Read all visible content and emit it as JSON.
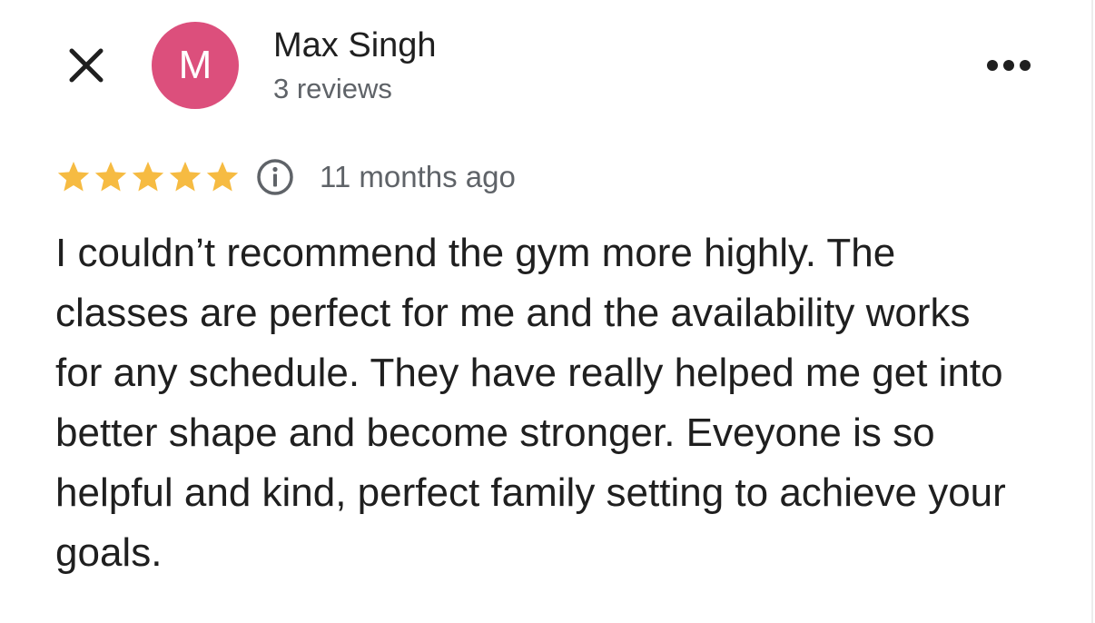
{
  "header": {
    "author": {
      "initial": "M",
      "name": "Max Singh",
      "review_count": "3 reviews",
      "avatar_color": "#dc4f7c"
    }
  },
  "icons": {
    "close": "close-icon",
    "more": "more-vert-dots-icon",
    "info": "info-icon",
    "star": "star-icon"
  },
  "review": {
    "rating": 5,
    "max_rating": 5,
    "time": "11 months ago",
    "text": "I couldn’t recommend the gym more highly. The classes are perfect for me and the availability works for any schedule. They have really helped me get into better shape and become stronger. Eveyone is so helpful and kind, perfect family setting to achieve your goals."
  },
  "colors": {
    "star": "#f6bb42",
    "text": "#1f1f1f",
    "secondary_text": "#5f6368"
  }
}
